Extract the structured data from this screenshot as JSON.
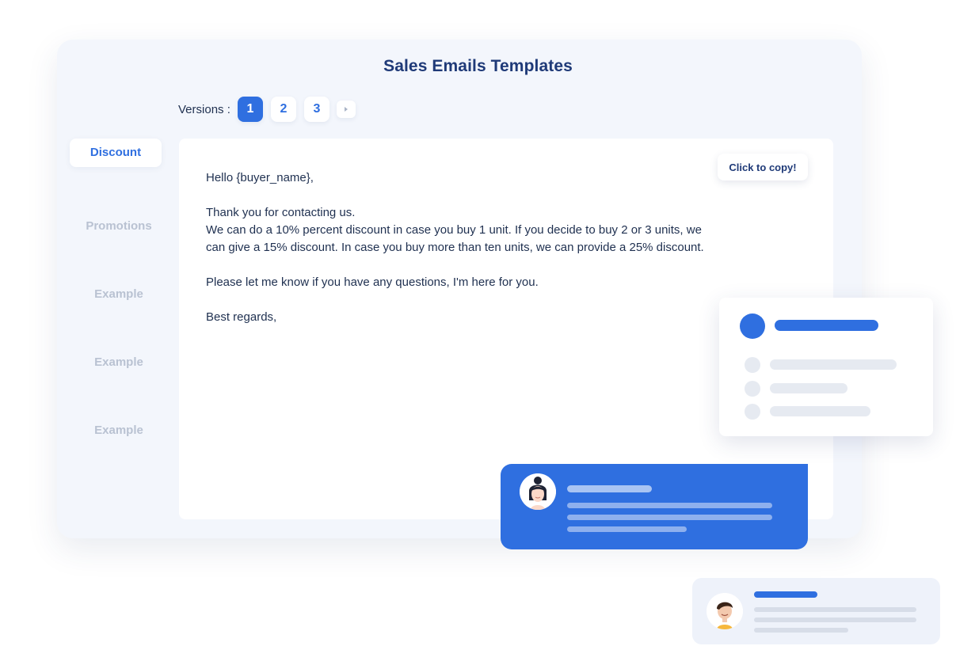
{
  "app": {
    "title": "Sales Emails Templates"
  },
  "versions": {
    "label": "Versions :",
    "pages": [
      "1",
      "2",
      "3"
    ],
    "active": "1",
    "next_icon": "play-triangle-icon"
  },
  "sidebar": {
    "items": [
      {
        "label": "Discount",
        "active": true
      },
      {
        "label": "Promotions",
        "active": false
      },
      {
        "label": "Example",
        "active": false
      },
      {
        "label": "Example",
        "active": false
      },
      {
        "label": "Example",
        "active": false
      }
    ]
  },
  "email": {
    "copy_label": "Click to copy!",
    "greeting": "Hello {buyer_name},",
    "body_line1": "Thank you for contacting us.",
    "body_line2": "We can do a 10% percent discount in case you buy 1 unit.  If you decide to buy 2 or 3 units, we can give a 15% discount. In case you buy more than ten units, we can provide a 25% discount.",
    "body_line3": "Please let me know if you have any questions, I'm here for you.",
    "signoff": "Best regards,"
  },
  "colors": {
    "accent": "#2f6fe0",
    "title": "#1f3a78",
    "text": "#1f3050",
    "muted": "#b9c2d2",
    "background": "#f3f6fc"
  }
}
